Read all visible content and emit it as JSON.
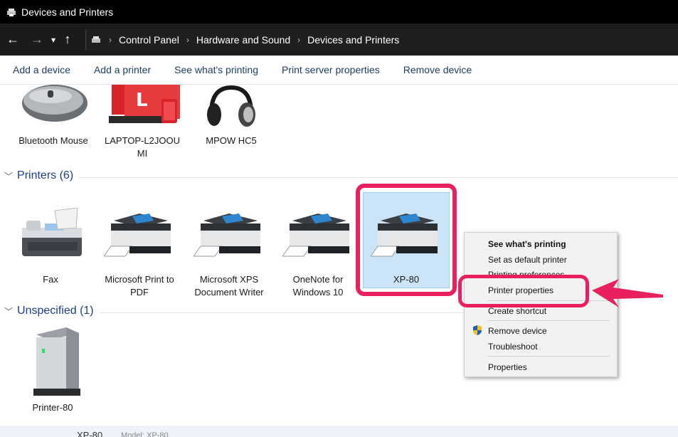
{
  "window": {
    "title": "Devices and Printers"
  },
  "address": {
    "crumbs": [
      "Control Panel",
      "Hardware and Sound",
      "Devices and Printers"
    ]
  },
  "toolbar": {
    "add_device": "Add a device",
    "add_printer": "Add a printer",
    "see_printing": "See what's printing",
    "print_server": "Print server properties",
    "remove_device": "Remove device"
  },
  "devices": {
    "mouse": "Bluetooth Mouse",
    "laptop_line1": "LAPTOP-L2JOOU",
    "laptop_line2": "MI",
    "headset": "MPOW HC5"
  },
  "printers_group": {
    "label": "Printers (6)"
  },
  "printers": {
    "fax": "Fax",
    "pdf_line1": "Microsoft Print to",
    "pdf_line2": "PDF",
    "xps_line1": "Microsoft XPS",
    "xps_line2": "Document Writer",
    "onenote_line1": "OneNote for",
    "onenote_line2": "Windows 10",
    "xp80": "XP-80"
  },
  "unspecified_group": {
    "label": "Unspecified (1)"
  },
  "unspecified": {
    "printer80": "Printer-80"
  },
  "context_menu": {
    "see_printing": "See what's printing",
    "set_default": "Set as default printer",
    "printing_prefs": "Printing preferences",
    "printer_props": "Printer properties",
    "create_shortcut": "Create shortcut",
    "remove_device": "Remove device",
    "troubleshoot": "Troubleshoot",
    "properties": "Properties"
  },
  "status": {
    "name": "XP-80",
    "model": "Model: XP-80"
  },
  "colors": {
    "highlight": "#e8205e",
    "selection": "#cce4f7",
    "link": "#1e3e63"
  }
}
